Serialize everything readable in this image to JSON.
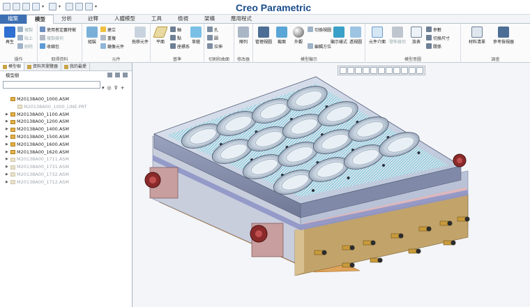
{
  "app": {
    "title": "Creo Parametric"
  },
  "tabs": [
    {
      "label": "檔案"
    },
    {
      "label": "模型"
    },
    {
      "label": "分析"
    },
    {
      "label": "註釋"
    },
    {
      "label": "人體模型"
    },
    {
      "label": "工具"
    },
    {
      "label": "檢視"
    },
    {
      "label": "架構"
    },
    {
      "label": "應用程式"
    }
  ],
  "ribbon": {
    "groups": {
      "operations": "操作",
      "get_data": "取得資料",
      "component": "元件",
      "datum": "基準",
      "cut_surface": "切割和曲面",
      "modifier": "修改器",
      "model_display": "模型顯示",
      "model_intent": "模型意圖",
      "investigate": "調查"
    },
    "buttons": {
      "regenerate": "再生",
      "copy": "複製",
      "paste": "貼上",
      "delete": "刪除",
      "user_defined_feature": "使用者定義特徵",
      "copy_geometry": "複製幾何",
      "shrinkwrap": "收縮包",
      "assemble": "組裝",
      "create": "建立",
      "repeat": "重複",
      "mirror_component": "鏡像元件",
      "drag_components": "拖移元件",
      "plane": "平面",
      "axis": "軸",
      "point": "點",
      "coordinate_system": "座標系",
      "sketch": "草繪",
      "hole": "孔",
      "pattern_ref": "圓",
      "extrude": "拉伸",
      "pattern": "陣列",
      "manage_views": "管理視圖",
      "section": "截面",
      "appearance": "外觀",
      "display_style": "顯示樣式",
      "perspective": "透視圖",
      "edit_position": "編輯方位",
      "switch_view": "切換視圖",
      "component_interface": "元件介面",
      "publish_geometry": "發佈幾何",
      "family_table": "族表",
      "parameters": "參數",
      "switch_dimensions": "切換尺寸",
      "relations": "關係",
      "bill_of_materials": "材料清單",
      "reference_viewer": "參考檢視器"
    }
  },
  "left_pane": {
    "tabs": [
      {
        "label": "模型樹"
      },
      {
        "label": "資料夾瀏覽器"
      },
      {
        "label": "我的最愛"
      }
    ],
    "tree_header": "模型樹",
    "search_placeholder": "",
    "tree": [
      {
        "label": "M20138A00_1000.ASM",
        "expandable": false,
        "dim": false
      },
      {
        "label": "M20138A00_1000_LINE.PRT",
        "expandable": false,
        "dim": true
      },
      {
        "label": "M20138A00_1100.ASM",
        "expandable": true,
        "dim": false
      },
      {
        "label": "M20138A00_1200.ASM",
        "expandable": true,
        "dim": false
      },
      {
        "label": "M20138A00_1400.ASM",
        "expandable": true,
        "dim": false
      },
      {
        "label": "M20138A00_1500.ASM",
        "expandable": true,
        "dim": false
      },
      {
        "label": "M20138A00_1600.ASM",
        "expandable": true,
        "dim": false
      },
      {
        "label": "M20138A00_1620.ASM",
        "expandable": true,
        "dim": false
      },
      {
        "label": "M20138A00_1711.ASM",
        "expandable": true,
        "dim": true
      },
      {
        "label": "M20138A00_1731.ASM",
        "expandable": true,
        "dim": true
      },
      {
        "label": "M20138A00_1732.ASM",
        "expandable": true,
        "dim": true
      },
      {
        "label": "M20138A00_1712.ASM",
        "expandable": true,
        "dim": true
      }
    ]
  },
  "colors": {
    "accent": "#3d6fb3",
    "title": "#1a4c8c",
    "mold_plate": "#cfd6e6",
    "cavity_cyan": "#2fb9c9",
    "bottom_plate": "#e0a35a",
    "cylinder": "#8b2a2a"
  },
  "icons": [
    "regenerate-icon",
    "copy-icon",
    "paste-icon",
    "delete-icon",
    "udf-icon",
    "assemble-icon",
    "plane-icon",
    "axis-icon",
    "sketch-icon",
    "hole-icon",
    "pattern-icon",
    "view-manager-icon",
    "section-icon",
    "appearance-icon",
    "display-style-icon",
    "perspective-icon",
    "family-table-icon",
    "parameters-icon",
    "bom-icon",
    "reference-viewer-icon"
  ]
}
